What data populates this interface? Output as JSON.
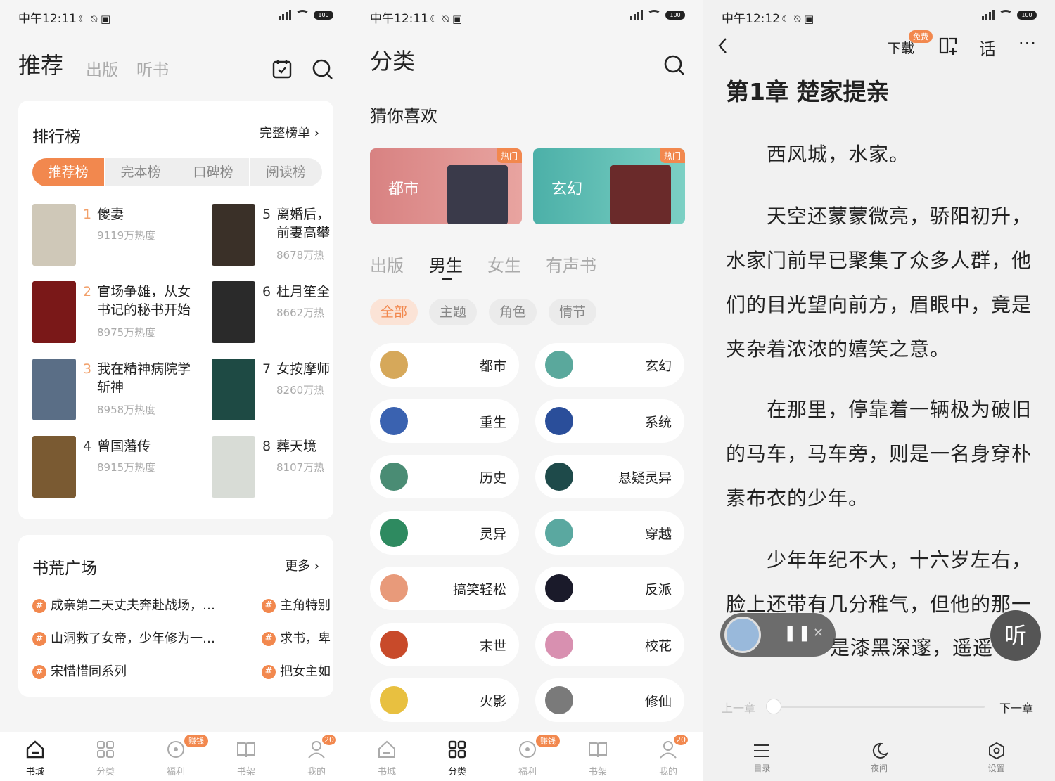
{
  "status": {
    "p1_time": "中午12:11",
    "p2_time": "中午12:11",
    "p3_time": "中午12:12",
    "battery": "100"
  },
  "p1": {
    "tabs": [
      "推荐",
      "出版",
      "听书"
    ],
    "rank": {
      "title": "排行榜",
      "more": "完整榜单 ›",
      "segments": [
        "推荐榜",
        "完本榜",
        "口碑榜",
        "阅读榜"
      ],
      "items": [
        {
          "num": "1",
          "title": "傻妻",
          "title2": "",
          "heat": "9119万热度",
          "color": "#cfc8b8"
        },
        {
          "num": "2",
          "title": "官场争雄，从女",
          "title2": "书记的秘书开始",
          "heat": "8975万热度",
          "color": "#7a1818"
        },
        {
          "num": "3",
          "title": "我在精神病院学",
          "title2": "斩神",
          "heat": "8958万热度",
          "color": "#5a6e86"
        },
        {
          "num": "4",
          "title": "曾国藩传",
          "title2": "",
          "heat": "8915万热度",
          "color": "#7a5a32"
        },
        {
          "num": "5",
          "title": "离婚后，",
          "title2": "前妻高攀",
          "heat": "8678万热",
          "color": "#3a3028"
        },
        {
          "num": "6",
          "title": "杜月笙全",
          "title2": "",
          "heat": "8662万热",
          "color": "#2a2a2a"
        },
        {
          "num": "7",
          "title": "女按摩师",
          "title2": "",
          "heat": "8260万热",
          "color": "#1e4a44"
        },
        {
          "num": "8",
          "title": "葬天境",
          "title2": "",
          "heat": "8107万热",
          "color": "#d8dcd6"
        }
      ]
    },
    "square": {
      "title": "书荒广场",
      "more": "更多 ›",
      "topics": [
        "成亲第二天丈夫奔赴战场，…",
        "山洞救了女帝，少年修为一…",
        "宋惜惜同系列",
        "主角特别",
        "求书，卑",
        "把女主如"
      ]
    }
  },
  "p2": {
    "title": "分类",
    "guess": "猜你喜欢",
    "banners": [
      {
        "label": "都市",
        "hot": "热门",
        "c1": "#d88282",
        "c2": "#e8a4a0"
      },
      {
        "label": "玄幻",
        "hot": "热门",
        "c1": "#4cb0a8",
        "c2": "#7cd0c4"
      }
    ],
    "tabs": [
      "出版",
      "男生",
      "女生",
      "有声书"
    ],
    "chips": [
      "全部",
      "主题",
      "角色",
      "情节"
    ],
    "cats": [
      {
        "label": "都市",
        "color": "#d6a85a"
      },
      {
        "label": "玄幻",
        "color": "#5aa89c"
      },
      {
        "label": "重生",
        "color": "#3a62b0"
      },
      {
        "label": "系统",
        "color": "#2a4e9a"
      },
      {
        "label": "历史",
        "color": "#4a8c74"
      },
      {
        "label": "悬疑灵异",
        "color": "#1e4a4a"
      },
      {
        "label": "灵异",
        "color": "#2e8a60"
      },
      {
        "label": "穿越",
        "color": "#5aa8a0"
      },
      {
        "label": "搞笑轻松",
        "color": "#e89a7a"
      },
      {
        "label": "反派",
        "color": "#1a1a2a"
      },
      {
        "label": "末世",
        "color": "#c84a2a"
      },
      {
        "label": "校花",
        "color": "#d890b0"
      },
      {
        "label": "火影",
        "color": "#e8c040"
      },
      {
        "label": "修仙",
        "color": "#7a7a7a"
      }
    ]
  },
  "nav": {
    "items": [
      "书城",
      "分类",
      "福利",
      "书架",
      "我的"
    ],
    "earn_badge": "赚钱",
    "msg_badge": "20"
  },
  "p3": {
    "download": "下载",
    "free": "免费",
    "chapter": "第1章 楚家提亲",
    "lines": [
      "西风城，水家。",
      "天空还蒙蒙微亮，骄阳初升，",
      "水家门前早已聚集了众多人群，他",
      "们的目光望向前方，眉眼中，竟是",
      "夹杂着浓浓的嬉笑之意。",
      "在那里，停靠着一辆极为破旧",
      "的马车，马车旁，则是一名身穿朴",
      "素布衣的少年。",
      "少年年纪不大，十六岁左右，",
      "脸上还带有几分稚气，但他的那一",
      "是漆黑深邃，遥遥"
    ],
    "listen": "听",
    "prev": "上一章",
    "next": "下一章",
    "bottom": [
      "目录",
      "夜间",
      "设置"
    ],
    "progress": 0.0
  }
}
